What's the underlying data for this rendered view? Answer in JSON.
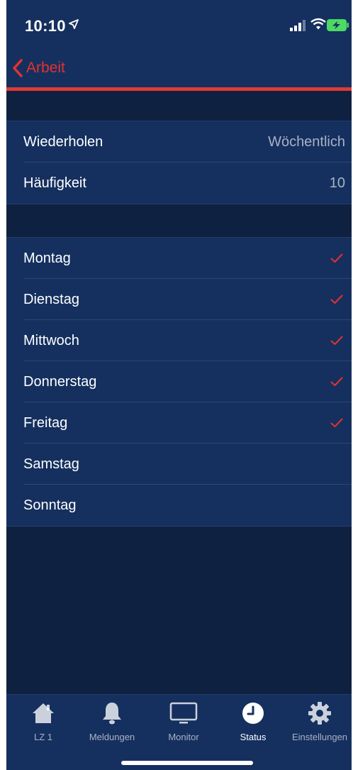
{
  "status_bar": {
    "time": "10:10",
    "location_icon": "location-arrow-icon",
    "signal_icon": "cellular-signal-icon",
    "wifi_icon": "wifi-icon",
    "battery_icon": "battery-charging-icon"
  },
  "nav": {
    "back_label": "Arbeit",
    "back_icon": "chevron-left-icon"
  },
  "colors": {
    "background": "#0f2140",
    "surface": "#15305f",
    "accent": "#e5312f",
    "secondary_text": "#a9b2c3"
  },
  "repeat_group": {
    "rows": [
      {
        "label": "Wiederholen",
        "value": "Wöchentlich"
      },
      {
        "label": "Häufigkeit",
        "value": "10"
      }
    ]
  },
  "days_group": {
    "rows": [
      {
        "label": "Montag",
        "checked": true
      },
      {
        "label": "Dienstag",
        "checked": true
      },
      {
        "label": "Mittwoch",
        "checked": true
      },
      {
        "label": "Donnerstag",
        "checked": true
      },
      {
        "label": "Freitag",
        "checked": true
      },
      {
        "label": "Samstag",
        "checked": false
      },
      {
        "label": "Sonntag",
        "checked": false
      }
    ]
  },
  "tab_bar": {
    "tabs": [
      {
        "label": "LZ 1",
        "icon": "home-icon",
        "active": false
      },
      {
        "label": "Meldungen",
        "icon": "bell-icon",
        "active": false
      },
      {
        "label": "Monitor",
        "icon": "monitor-icon",
        "active": false
      },
      {
        "label": "Status",
        "icon": "clock-icon",
        "active": true
      },
      {
        "label": "Einstellungen",
        "icon": "gear-icon",
        "active": false
      }
    ]
  }
}
